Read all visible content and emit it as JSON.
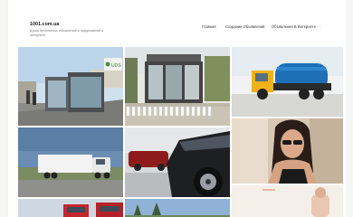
{
  "header": {
    "site_title": "1001.com.ua",
    "tagline": "Доска бесплатных объявлений и предложений в интернете"
  },
  "nav": {
    "items": [
      {
        "label": "Главная"
      },
      {
        "label": "Создание Объявлений"
      },
      {
        "label": "Объявления В Интернете"
      }
    ],
    "more_glyph": "›"
  },
  "tiles": [
    {
      "name": "bus-stop-kiosk-photo",
      "sign_text": "UDS"
    },
    {
      "name": "retail-kiosk-photo"
    },
    {
      "name": "vacuum-truck-photo"
    },
    {
      "name": "semi-truck-photo"
    },
    {
      "name": "suv-car-photo"
    },
    {
      "name": "woman-sunglasses-photo"
    },
    {
      "name": "red-trucks-photo"
    },
    {
      "name": "sky-landscape-photo"
    },
    {
      "name": "bright-room-photo"
    }
  ],
  "colors": {
    "background": "#f5f5f3",
    "sheet": "#ffffff",
    "title": "#222222",
    "tagline": "#777777",
    "nav": "#333333"
  }
}
